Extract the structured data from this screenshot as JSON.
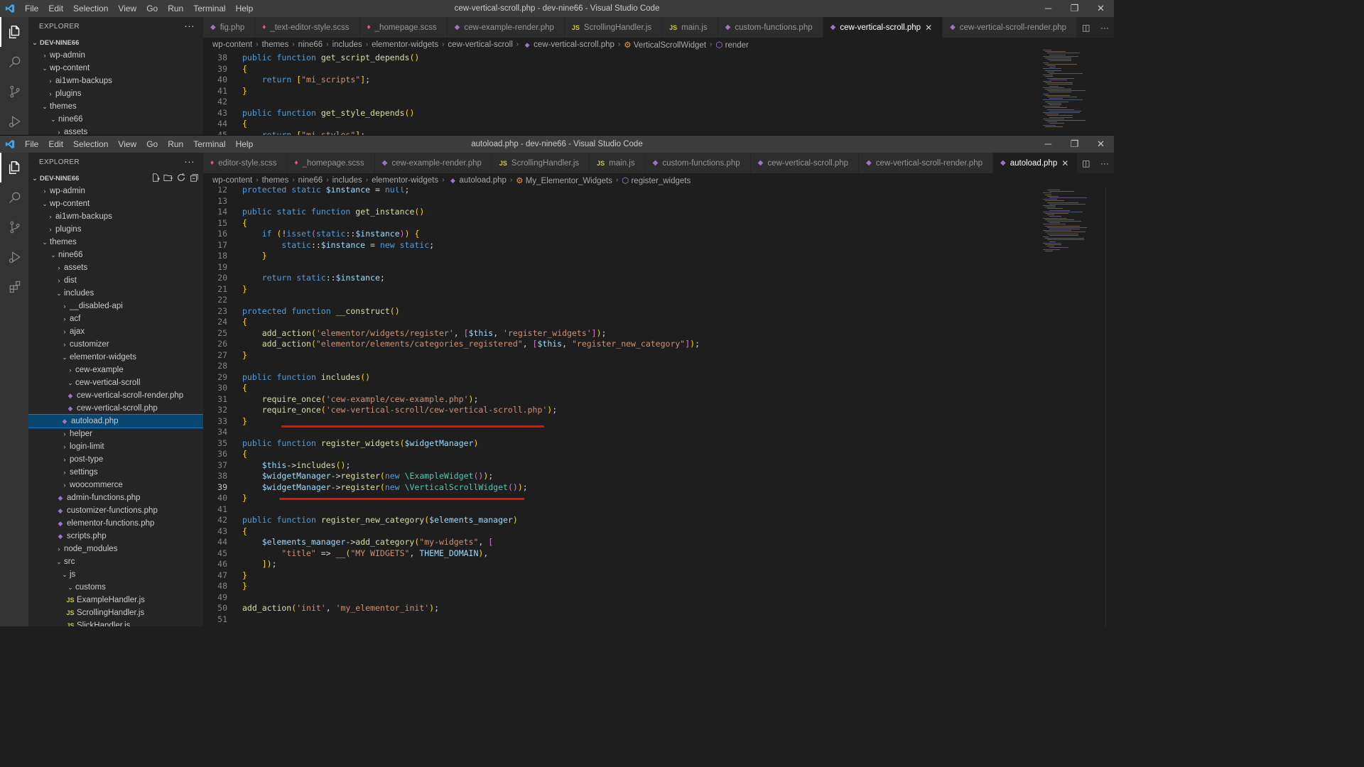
{
  "menu": [
    "File",
    "Edit",
    "Selection",
    "View",
    "Go",
    "Run",
    "Terminal",
    "Help"
  ],
  "window_controls": [
    "minimize-icon",
    "restore-icon",
    "close-icon"
  ],
  "top": {
    "title": "cew-vertical-scroll.php - dev-nine66 - Visual Studio Code",
    "explorer_label": "EXPLORER",
    "section": "DEV-NINE66",
    "tree": [
      {
        "label": "wp-admin",
        "chev": "›"
      },
      {
        "label": "wp-content",
        "chev": "⌄"
      },
      {
        "label": "ai1wm-backups",
        "chev": "›"
      },
      {
        "label": "plugins",
        "chev": "›"
      },
      {
        "label": "themes",
        "chev": "⌄"
      },
      {
        "label": "nine66",
        "chev": "⌄"
      },
      {
        "label": "assets",
        "chev": "›"
      }
    ],
    "tabs": [
      {
        "label": "fig.php",
        "icon": "php"
      },
      {
        "label": "_text-editor-style.scss",
        "icon": "scss"
      },
      {
        "label": "_homepage.scss",
        "icon": "scss"
      },
      {
        "label": "cew-example-render.php",
        "icon": "php"
      },
      {
        "label": "ScrollingHandler.js",
        "icon": "js"
      },
      {
        "label": "main.js",
        "icon": "js"
      },
      {
        "label": "custom-functions.php",
        "icon": "php"
      },
      {
        "label": "cew-vertical-scroll.php",
        "icon": "php",
        "active": true
      },
      {
        "label": "cew-vertical-scroll-render.php",
        "icon": "php"
      }
    ],
    "breadcrumb": [
      "wp-content",
      "themes",
      "nine66",
      "includes",
      "elementor-widgets",
      "cew-vertical-scroll",
      "cew-vertical-scroll.php",
      "VerticalScrollWidget",
      "render"
    ],
    "lines": [
      {
        "n": "38",
        "code": "public function get_script_depends()"
      },
      {
        "n": "39",
        "code": "{"
      },
      {
        "n": "40",
        "code": "    return [\"mi_scripts\"];"
      },
      {
        "n": "41",
        "code": "}"
      },
      {
        "n": "42",
        "code": ""
      },
      {
        "n": "43",
        "code": "public function get_style_depends()"
      },
      {
        "n": "44",
        "code": "{"
      },
      {
        "n": "45",
        "code": "    return [\"mi_styles\"];"
      }
    ]
  },
  "bottom": {
    "title": "autoload.php - dev-nine66 - Visual Studio Code",
    "explorer_label": "EXPLORER",
    "section": "DEV-NINE66",
    "tree": [
      {
        "label": "wp-admin",
        "chev": "›"
      },
      {
        "label": "wp-content",
        "chev": "⌄"
      },
      {
        "label": "ai1wm-backups",
        "chev": "›"
      },
      {
        "label": "plugins",
        "chev": "›"
      },
      {
        "label": "themes",
        "chev": "⌄"
      },
      {
        "label": "nine66",
        "chev": "⌄"
      },
      {
        "label": "assets",
        "chev": "›"
      },
      {
        "label": "dist",
        "chev": "›"
      },
      {
        "label": "includes",
        "chev": "⌄"
      },
      {
        "label": "__disabled-api",
        "chev": "›"
      },
      {
        "label": "acf",
        "chev": "›"
      },
      {
        "label": "ajax",
        "chev": "›"
      },
      {
        "label": "customizer",
        "chev": "›"
      },
      {
        "label": "elementor-widgets",
        "chev": "⌄"
      },
      {
        "label": "cew-example",
        "chev": "›"
      },
      {
        "label": "cew-vertical-scroll",
        "chev": "⌄"
      },
      {
        "label": "cew-vertical-scroll-render.php",
        "icon": "php"
      },
      {
        "label": "cew-vertical-scroll.php",
        "icon": "php"
      },
      {
        "label": "autoload.php",
        "icon": "php",
        "selected": true
      },
      {
        "label": "helper",
        "chev": "›"
      },
      {
        "label": "login-limit",
        "chev": "›"
      },
      {
        "label": "post-type",
        "chev": "›"
      },
      {
        "label": "settings",
        "chev": "›"
      },
      {
        "label": "woocommerce",
        "chev": "›"
      },
      {
        "label": "admin-functions.php",
        "icon": "php"
      },
      {
        "label": "customizer-functions.php",
        "icon": "php"
      },
      {
        "label": "elementor-functions.php",
        "icon": "php"
      },
      {
        "label": "scripts.php",
        "icon": "php"
      },
      {
        "label": "node_modules",
        "chev": "›"
      },
      {
        "label": "src",
        "chev": "⌄"
      },
      {
        "label": "js",
        "chev": "⌄"
      },
      {
        "label": "customs",
        "chev": "⌄"
      },
      {
        "label": "ExampleHandler.js",
        "icon": "js"
      },
      {
        "label": "ScrollingHandler.js",
        "icon": "js"
      },
      {
        "label": "SlickHandler.js",
        "icon": "js"
      }
    ],
    "tabs": [
      {
        "label": "editor-style.scss",
        "icon": "scss"
      },
      {
        "label": "_homepage.scss",
        "icon": "scss"
      },
      {
        "label": "cew-example-render.php",
        "icon": "php"
      },
      {
        "label": "ScrollingHandler.js",
        "icon": "js"
      },
      {
        "label": "main.js",
        "icon": "js"
      },
      {
        "label": "custom-functions.php",
        "icon": "php"
      },
      {
        "label": "cew-vertical-scroll.php",
        "icon": "php"
      },
      {
        "label": "cew-vertical-scroll-render.php",
        "icon": "php"
      },
      {
        "label": "autoload.php",
        "icon": "php",
        "active": true
      }
    ],
    "breadcrumb": [
      "wp-content",
      "themes",
      "nine66",
      "includes",
      "elementor-widgets",
      "autoload.php",
      "My_Elementor_Widgets",
      "register_widgets"
    ],
    "lines": [
      {
        "n": "12",
        "code": "protected static $instance = null;"
      },
      {
        "n": "13",
        "code": ""
      },
      {
        "n": "14",
        "code": "public static function get_instance()"
      },
      {
        "n": "15",
        "code": "{"
      },
      {
        "n": "16",
        "code": "    if (!isset(static::$instance)) {"
      },
      {
        "n": "17",
        "code": "        static::$instance = new static;"
      },
      {
        "n": "18",
        "code": "    }"
      },
      {
        "n": "19",
        "code": ""
      },
      {
        "n": "20",
        "code": "    return static::$instance;"
      },
      {
        "n": "21",
        "code": "}"
      },
      {
        "n": "22",
        "code": ""
      },
      {
        "n": "23",
        "code": "protected function __construct()"
      },
      {
        "n": "24",
        "code": "{"
      },
      {
        "n": "25",
        "code": "    add_action('elementor/widgets/register', [$this, 'register_widgets']);"
      },
      {
        "n": "26",
        "code": "    add_action(\"elementor/elements/categories_registered\", [$this, \"register_new_category\"]);"
      },
      {
        "n": "27",
        "code": "}"
      },
      {
        "n": "28",
        "code": ""
      },
      {
        "n": "29",
        "code": "public function includes()"
      },
      {
        "n": "30",
        "code": "{"
      },
      {
        "n": "31",
        "code": "    require_once('cew-example/cew-example.php');"
      },
      {
        "n": "32",
        "code": "    require_once('cew-vertical-scroll/cew-vertical-scroll.php');"
      },
      {
        "n": "33",
        "code": "}"
      },
      {
        "n": "34",
        "code": ""
      },
      {
        "n": "35",
        "code": "public function register_widgets($widgetManager)"
      },
      {
        "n": "36",
        "code": "{"
      },
      {
        "n": "37",
        "code": "    $this->includes();"
      },
      {
        "n": "38",
        "code": "    $widgetManager->register(new \\ExampleWidget());"
      },
      {
        "n": "39",
        "code": "    $widgetManager->register(new \\VerticalScrollWidget());"
      },
      {
        "n": "40",
        "code": "}"
      },
      {
        "n": "41",
        "code": ""
      },
      {
        "n": "42",
        "code": "public function register_new_category($elements_manager)"
      },
      {
        "n": "43",
        "code": "{"
      },
      {
        "n": "44",
        "code": "    $elements_manager->add_category(\"my-widgets\", ["
      },
      {
        "n": "45",
        "code": "        \"title\" => __(\"MY WIDGETS\", THEME_DOMAIN),"
      },
      {
        "n": "46",
        "code": "    ]);"
      },
      {
        "n": "47",
        "code": "}"
      },
      {
        "n": "48",
        "code": "}"
      },
      {
        "n": "49",
        "code": ""
      },
      {
        "n": "50",
        "code": "add_action('init', 'my_elementor_init');"
      },
      {
        "n": "51",
        "code": ""
      }
    ],
    "current_line": "39",
    "annotation_color": "#e51400"
  },
  "colors": {
    "accent": "#007acc",
    "selection": "#094771",
    "annotation": "#e51400"
  }
}
